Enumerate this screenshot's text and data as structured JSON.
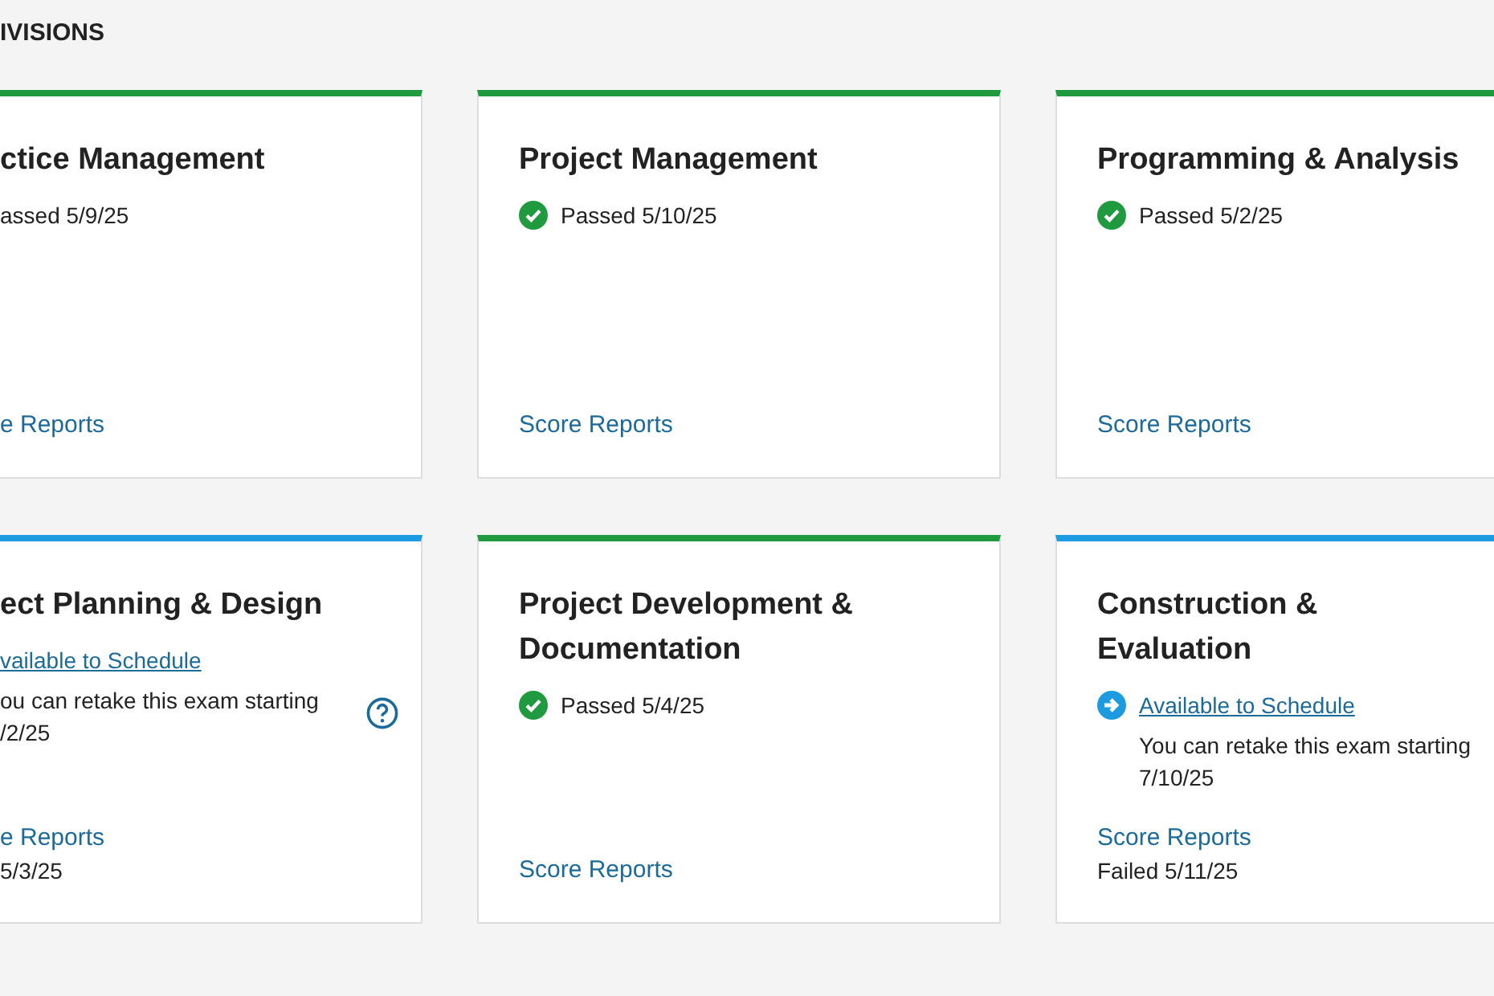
{
  "heading": "IVISIONS",
  "divisions": [
    {
      "title": "ctice Management",
      "cropped": true,
      "status": {
        "kind": "passed",
        "text": "assed 5/9/25"
      },
      "link": "e Reports"
    },
    {
      "title": "Project Management",
      "cropped": false,
      "status": {
        "kind": "passed",
        "text": "Passed 5/10/25"
      },
      "link": "Score Reports"
    },
    {
      "title": "Programming & Analysis",
      "cropped": false,
      "status": {
        "kind": "passed",
        "text": "Passed 5/2/25"
      },
      "link": "Score Reports"
    },
    {
      "title": "ect Planning & Design",
      "cropped": true,
      "status": {
        "kind": "available",
        "text": "vailable to Schedule"
      },
      "note": "ou can retake this exam starting",
      "note_date": "/2/25",
      "help": true,
      "link": "e Reports",
      "result": "5/3/25"
    },
    {
      "title": "Project Development & Documentation",
      "cropped": false,
      "status": {
        "kind": "passed",
        "text": "Passed 5/4/25"
      },
      "link": "Score Reports"
    },
    {
      "title": "Construction & Evaluation",
      "cropped": false,
      "status": {
        "kind": "available",
        "text": "Available to Schedule"
      },
      "note": "You can retake this exam starting",
      "note_date": "7/10/25",
      "help": false,
      "link": "Score Reports",
      "result": "Failed 5/11/25"
    }
  ]
}
